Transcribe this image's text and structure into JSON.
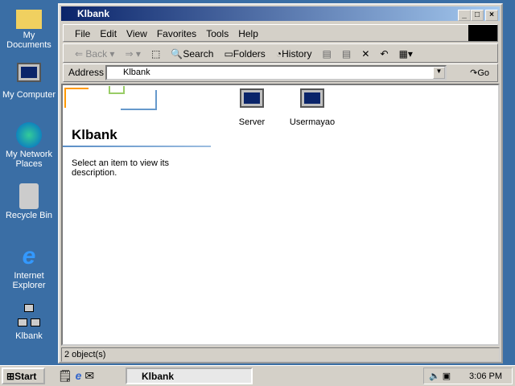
{
  "desktop": {
    "icons": [
      {
        "label": "My Documents"
      },
      {
        "label": "My Computer"
      },
      {
        "label": "My Network Places"
      },
      {
        "label": "Recycle Bin"
      },
      {
        "label": "Internet Explorer"
      },
      {
        "label": "Klbank"
      }
    ]
  },
  "window": {
    "title": "Klbank",
    "menu": [
      "File",
      "Edit",
      "View",
      "Favorites",
      "Tools",
      "Help"
    ],
    "toolbar": {
      "back": "Back",
      "search": "Search",
      "folders": "Folders",
      "history": "History"
    },
    "address": {
      "label": "Address",
      "value": "Klbank",
      "go": "Go"
    },
    "left_pane": {
      "title": "Klbank",
      "description": "Select an item to view its description."
    },
    "items": [
      {
        "label": "Server"
      },
      {
        "label": "Usermayao"
      }
    ],
    "status": "2 object(s)"
  },
  "taskbar": {
    "start": "Start",
    "task": "Klbank",
    "clock": "3:06 PM"
  }
}
